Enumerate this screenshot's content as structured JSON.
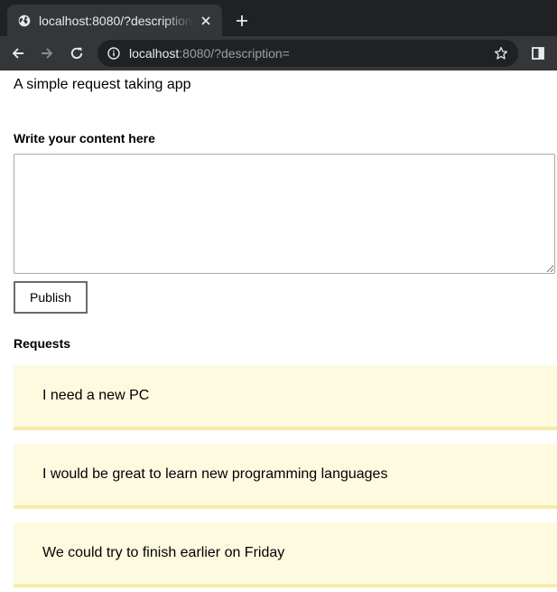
{
  "browser": {
    "tab_title": "localhost:8080/?description=",
    "url_host": "localhost",
    "url_rest": ":8080/?description=",
    "icons": {
      "favicon": "globe-icon",
      "close": "close-icon",
      "new_tab": "plus-icon",
      "back": "arrow-left-icon",
      "forward": "arrow-right-icon",
      "reload": "reload-icon",
      "info": "info-icon",
      "bookmark": "star-icon",
      "side_panel": "side-panel-icon"
    }
  },
  "app": {
    "title": "A simple request taking app"
  },
  "form": {
    "label": "Write your content here",
    "textarea_value": "",
    "publish_label": "Publish"
  },
  "requests": {
    "heading": "Requests",
    "items": [
      "I need a new PC",
      "I would be great to learn new programming languages",
      "We could try to finish earlier on Friday"
    ],
    "colors": {
      "background": "#fefae0",
      "border": "#f7eca9"
    }
  }
}
